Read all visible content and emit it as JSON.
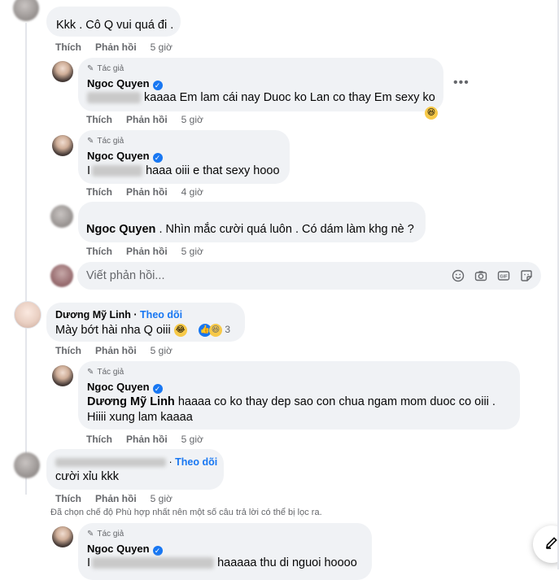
{
  "actions": {
    "like": "Thích",
    "reply": "Phản hồi"
  },
  "author_badge": "Tác giả",
  "follow_label": "Theo dõi",
  "comments": [
    {
      "id": "c1",
      "text": "Kkk . Cô Q vui quá đi .",
      "time": "5 giờ"
    },
    {
      "id": "r1",
      "name": "Ngoc Quyen",
      "text": "kaaaa Em lam cái nay Duoc ko Lan co thay Em sexy ko",
      "time": "5 giờ"
    },
    {
      "id": "r2",
      "name": "Ngoc Quyen",
      "text": "haaa oiii e that sexy hooo",
      "time": "4 giờ"
    },
    {
      "id": "r3",
      "mention": "Ngoc Quyen",
      "text": ". Nhìn mắc cười quá luôn . Có dám làm khg nè ?",
      "time": "5 giờ"
    },
    {
      "id": "c2",
      "name": "Dương Mỹ Linh",
      "text": "Mày bớt hài nha Q oiii",
      "reaction_count": "3",
      "time": "5 giờ"
    },
    {
      "id": "r4",
      "name": "Ngoc Quyen",
      "mention": "Dương Mỹ Linh",
      "text": "haaaa co ko thay dep sao con chua ngam mom duoc co oiii .",
      "text2": "Hiiii xung lam kaaaa",
      "time": "5 giờ"
    },
    {
      "id": "c3",
      "text": "cười xỉu kkk",
      "time": "5 giờ"
    },
    {
      "id": "r5",
      "name": "Ngoc Quyen",
      "text": "haaaaa thu di nguoi hoooo"
    }
  ],
  "reply_box": {
    "placeholder": "Viết phản hồi..."
  },
  "filter_note": "Đã chọn chế độ Phù hợp nhất nên một số câu trả lời có thể bị lọc ra.",
  "icons": [
    "emoji-icon",
    "camera-icon",
    "gif-icon",
    "sticker-icon",
    "pen-icon",
    "verified-icon",
    "more-icon",
    "edit-icon"
  ],
  "colors": {
    "link": "#1877f2",
    "bubble": "#f0f2f5",
    "muted": "#65676b"
  }
}
